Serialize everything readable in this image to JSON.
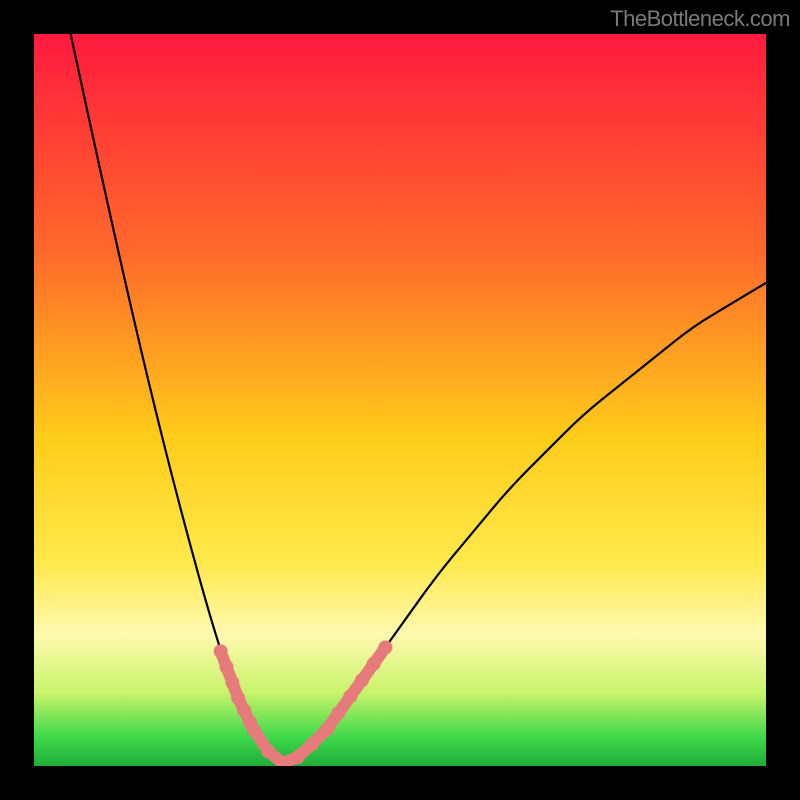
{
  "watermark": "TheBottleneck.com",
  "chart_data": {
    "type": "line",
    "title": "",
    "xlabel": "",
    "ylabel": "",
    "xlim": [
      0,
      1
    ],
    "ylim": [
      0,
      1
    ],
    "minimum_x": 0.345,
    "series": [
      {
        "name": "curve",
        "color": "#000000",
        "x": [
          0.05,
          0.1,
          0.15,
          0.2,
          0.25,
          0.28,
          0.3,
          0.32,
          0.345,
          0.37,
          0.4,
          0.45,
          0.5,
          0.55,
          0.6,
          0.65,
          0.7,
          0.75,
          0.8,
          0.85,
          0.9,
          0.95,
          1.0
        ],
        "y": [
          1.0,
          0.77,
          0.55,
          0.35,
          0.17,
          0.09,
          0.05,
          0.02,
          0.0,
          0.02,
          0.05,
          0.12,
          0.19,
          0.26,
          0.32,
          0.38,
          0.43,
          0.48,
          0.52,
          0.56,
          0.6,
          0.63,
          0.66
        ]
      }
    ],
    "dot_clusters": [
      {
        "name": "left-segment",
        "color": "#e77b7b",
        "x_range": [
          0.255,
          0.295
        ],
        "y_range": [
          0.06,
          0.17
        ]
      },
      {
        "name": "bottom-segment",
        "color": "#e77b7b",
        "x_range": [
          0.3,
          0.4
        ],
        "y_range": [
          0.0,
          0.04
        ]
      },
      {
        "name": "right-segment",
        "color": "#e77b7b",
        "x_range": [
          0.4,
          0.48
        ],
        "y_range": [
          0.05,
          0.17
        ]
      }
    ],
    "background": {
      "type": "vertical-gradient",
      "stops": [
        {
          "offset": 0.0,
          "color": "#ff1a3e"
        },
        {
          "offset": 0.3,
          "color": "#ff6a2a"
        },
        {
          "offset": 0.55,
          "color": "#ffcc1a"
        },
        {
          "offset": 0.72,
          "color": "#ffe94a"
        },
        {
          "offset": 0.82,
          "color": "#fff9b0"
        },
        {
          "offset": 0.9,
          "color": "#c8f46a"
        },
        {
          "offset": 0.96,
          "color": "#3fd94a"
        },
        {
          "offset": 1.0,
          "color": "#1fae3a"
        }
      ]
    }
  }
}
